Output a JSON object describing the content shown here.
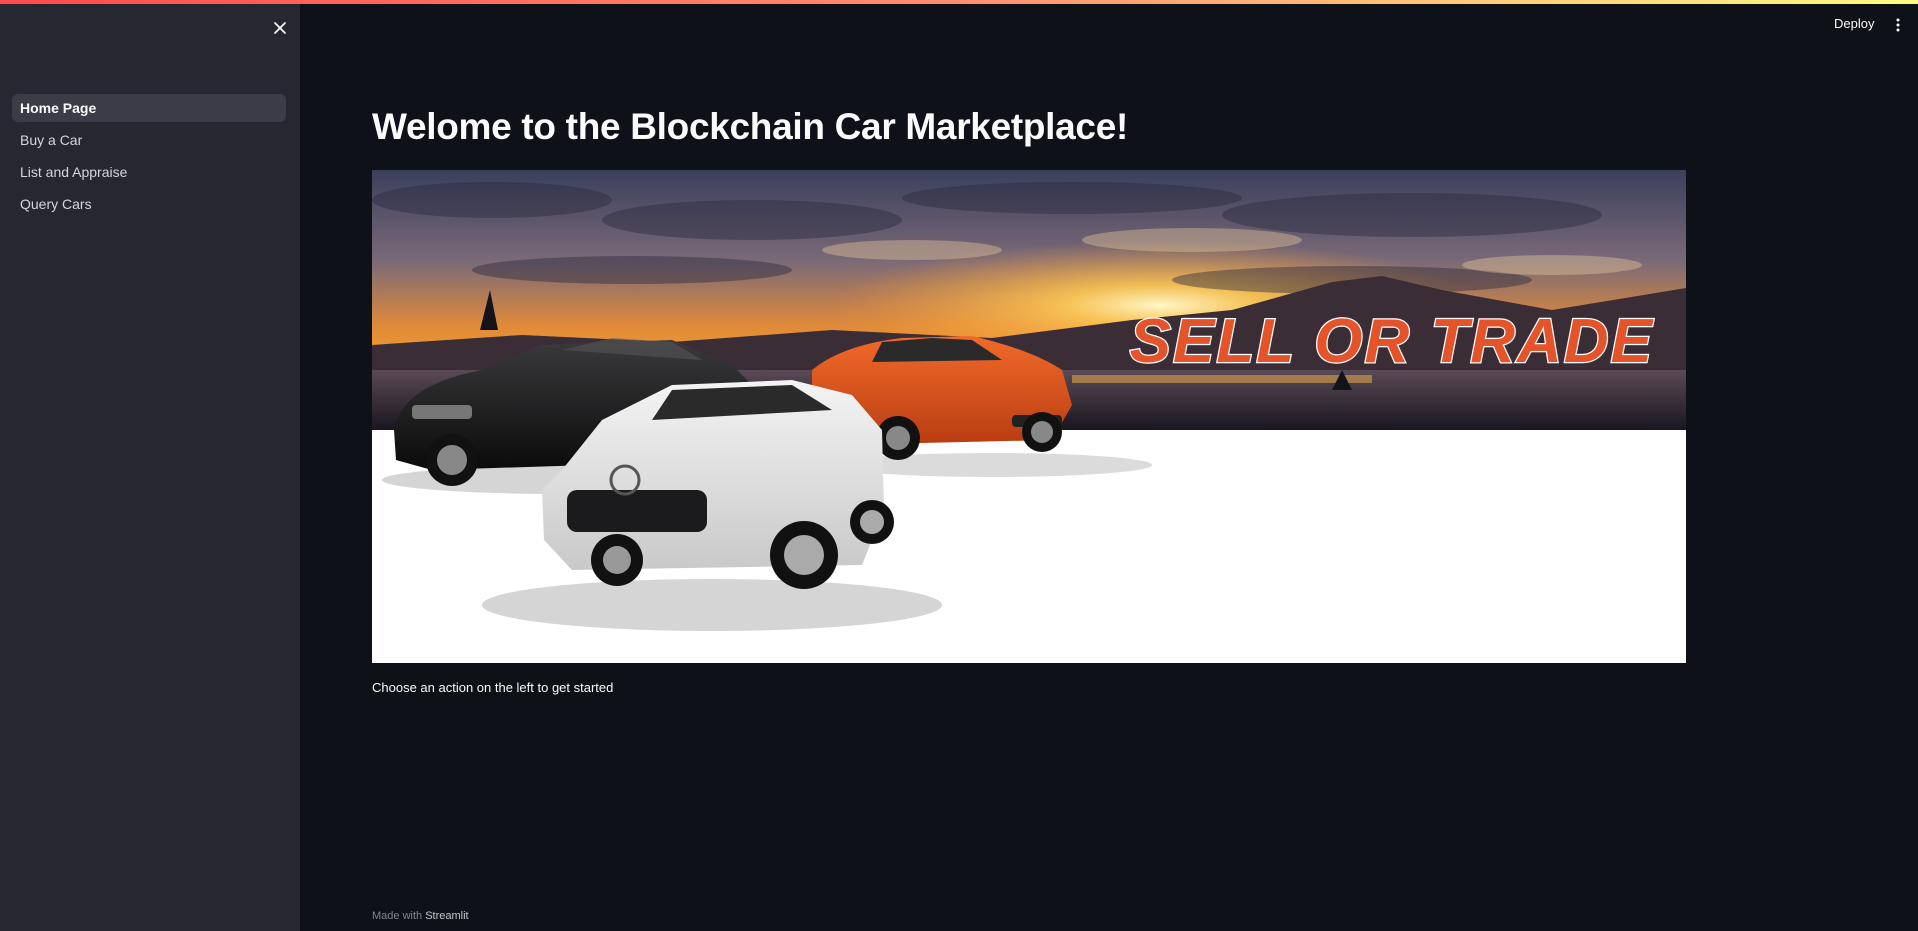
{
  "sidebar": {
    "items": [
      {
        "label": "Home Page",
        "active": true
      },
      {
        "label": "Buy a Car",
        "active": false
      },
      {
        "label": "List and Appraise",
        "active": false
      },
      {
        "label": "Query Cars",
        "active": false
      }
    ],
    "close_icon": "close-icon"
  },
  "header": {
    "deploy_label": "Deploy",
    "menu_icon": "more-vertical-icon"
  },
  "main": {
    "title": "Welome to the Blockchain Car Marketplace!",
    "hero": {
      "banner_text": "SELL OR TRADE"
    },
    "caption": "Choose an action on the left to get started"
  },
  "footer": {
    "made_with": "Made with",
    "brand": "Streamlit"
  },
  "colors": {
    "background": "#0e1117",
    "sidebar": "#262730",
    "text": "#fafafa",
    "accent_gradient_start": "#ff4b4b",
    "accent_gradient_end": "#fffd80"
  }
}
